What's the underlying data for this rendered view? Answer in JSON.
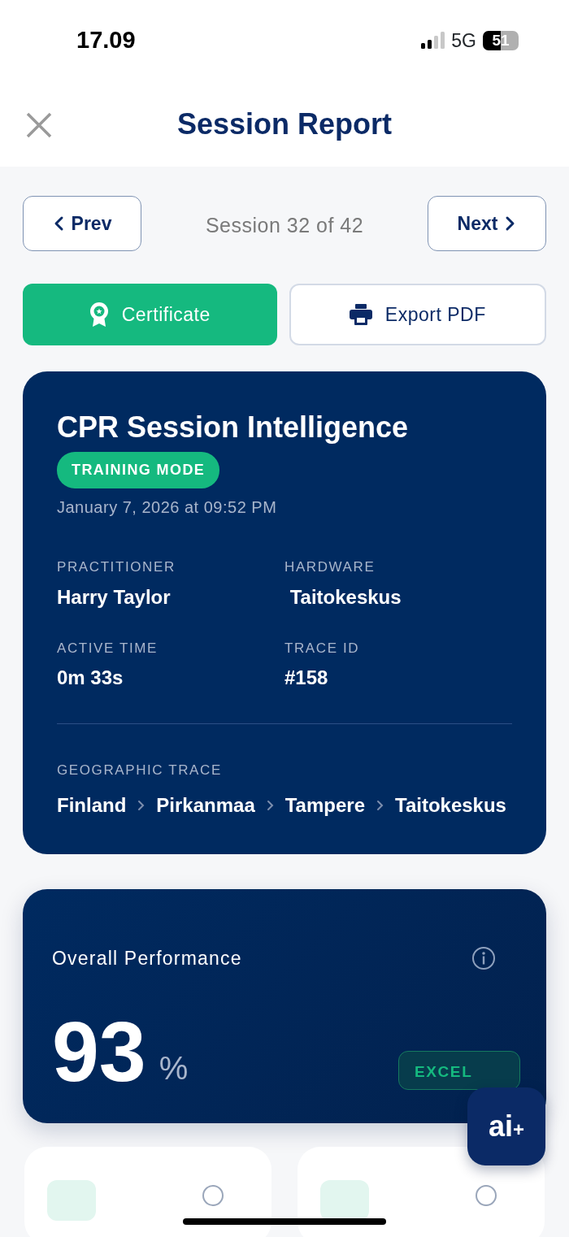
{
  "status_bar": {
    "time": "17.09",
    "network": "5G",
    "battery": "51"
  },
  "header": {
    "title": "Session Report"
  },
  "pager": {
    "prev": "Prev",
    "position": "Session 32 of 42",
    "next": "Next"
  },
  "actions": [
    {
      "kind": "certificate",
      "label": "Certificate"
    },
    {
      "kind": "export",
      "label": "Export PDF"
    }
  ],
  "session_card": {
    "title": "CPR Session Intelligence",
    "mode_badge": "TRAINING MODE",
    "date": "January 7, 2026 at 09:52 PM",
    "fields": [
      {
        "label": "PRACTITIONER",
        "value": "Harry Taylor"
      },
      {
        "label": "HARDWARE",
        "value": " Taitokeskus"
      },
      {
        "label": "ACTIVE TIME",
        "value": "0m 33s"
      },
      {
        "label": "TRACE ID",
        "value": "#158"
      }
    ],
    "trace_label": "GEOGRAPHIC TRACE",
    "trace": [
      "Finland",
      "Pirkanmaa",
      "Tampere",
      "Taitokeskus"
    ]
  },
  "performance_card": {
    "title": "Overall Performance",
    "score": "93",
    "unit": "%",
    "rating": "EXCEL"
  },
  "assistant_button": {
    "label": "ai$_{+}$"
  }
}
